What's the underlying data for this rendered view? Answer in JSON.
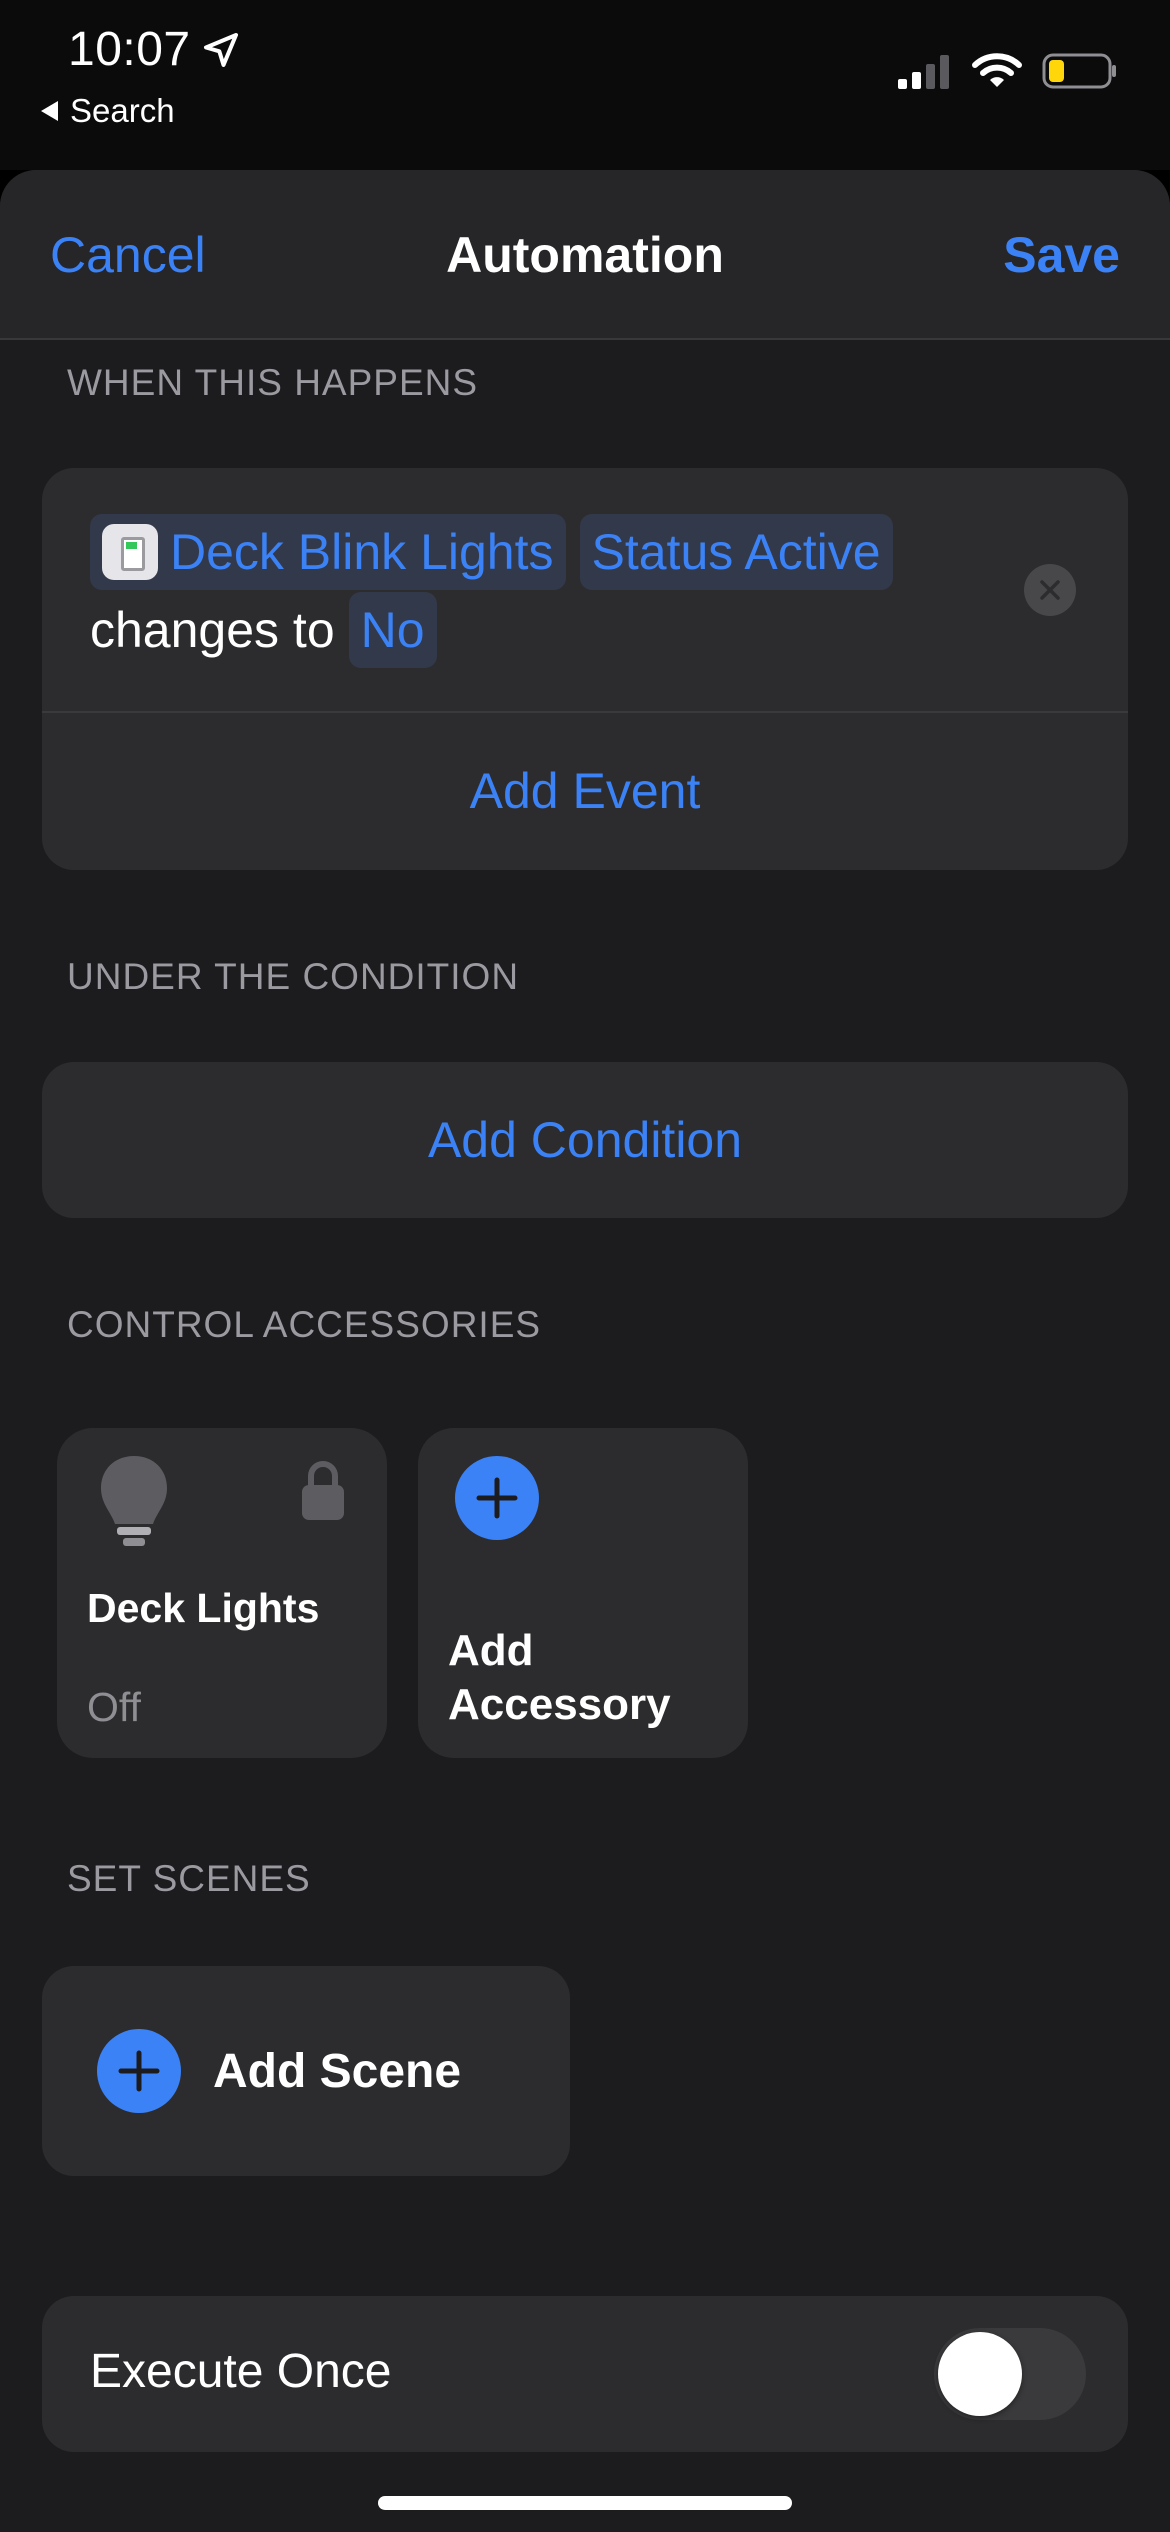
{
  "status_bar": {
    "time": "10:07",
    "back_label": "Search",
    "icons": [
      "location-arrow-icon",
      "cellular-signal-icon",
      "wifi-icon",
      "battery-icon"
    ]
  },
  "navbar": {
    "cancel_label": "Cancel",
    "title": "Automation",
    "save_label": "Save"
  },
  "trigger_section": {
    "header": "WHEN THIS HAPPENS",
    "event": {
      "accessory": "Deck Blink Lights",
      "characteristic": "Status Active",
      "connector": "changes to",
      "value": "No"
    },
    "add_event_label": "Add Event"
  },
  "condition_section": {
    "header": "UNDER THE CONDITION",
    "add_condition_label": "Add Condition"
  },
  "accessories_section": {
    "header": "CONTROL ACCESSORIES",
    "tiles": [
      {
        "name": "Deck Lights",
        "state": "Off",
        "icon": "lightbulb-icon",
        "locked": true
      }
    ],
    "add_accessory_label": "Add Accessory"
  },
  "scenes_section": {
    "header": "SET SCENES",
    "add_scene_label": "Add Scene"
  },
  "execute_once": {
    "label": "Execute Once",
    "enabled": false
  },
  "colors": {
    "accent": "#3b82f6",
    "background": "#1c1c1e",
    "card": "#2c2c2e",
    "secondary_text": "#9a9aa0"
  }
}
